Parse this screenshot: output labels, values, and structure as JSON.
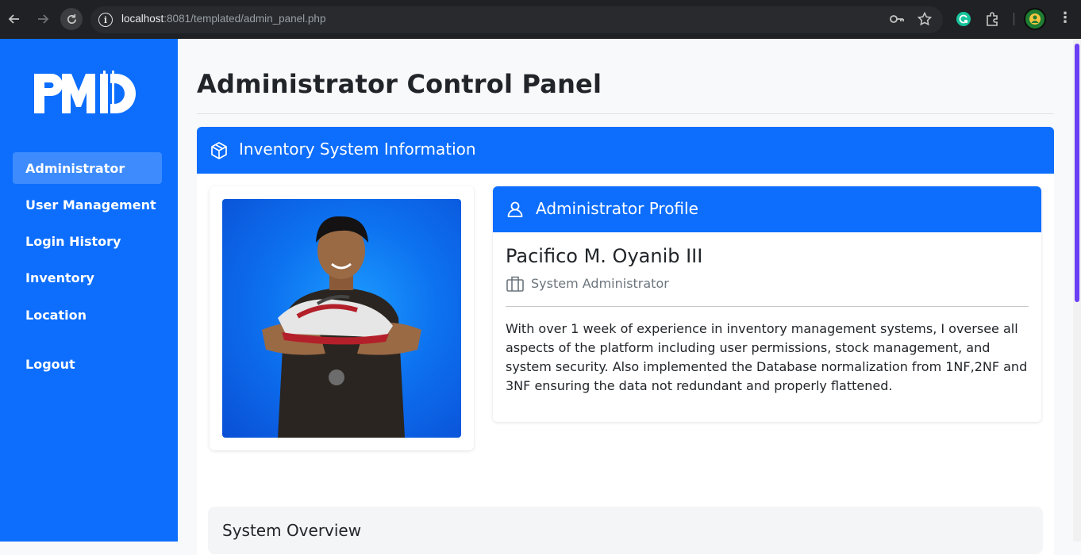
{
  "browser": {
    "url_host": "localhost",
    "url_rest": ":8081/templated/admin_panel.php",
    "icons": [
      "back-icon",
      "forward-icon",
      "reload-icon",
      "info-icon",
      "key-icon",
      "star-icon",
      "grammarly-icon",
      "extensions-icon",
      "profile-avatar",
      "menu-icon"
    ]
  },
  "sidebar": {
    "logo_text": "PMD",
    "items": [
      {
        "label": "Administrator",
        "active": true
      },
      {
        "label": "User Management",
        "active": false
      },
      {
        "label": "Login History",
        "active": false
      },
      {
        "label": "Inventory",
        "active": false
      },
      {
        "label": "Location",
        "active": false
      },
      {
        "label": "Logout",
        "active": false
      }
    ]
  },
  "main": {
    "page_title": "Administrator Control Panel",
    "section_header": "Inventory System Information",
    "profile": {
      "header": "Administrator Profile",
      "name": "Pacifico M. Oyanib III",
      "role": "System Administrator",
      "bio": "With over 1 week of experience in inventory management systems, I oversee all aspects of the platform including user permissions, stock management, and system security. Also implemented the Database normalization from 1NF,2NF and 3NF ensuring the data not redundant and properly flattened."
    },
    "overview_title": "System Overview"
  },
  "colors": {
    "primary": "#0d6efd",
    "sidebar_active": "#3d8bfd",
    "chrome_bg": "#202124",
    "scroll_thumb": "#6b3ff5"
  }
}
